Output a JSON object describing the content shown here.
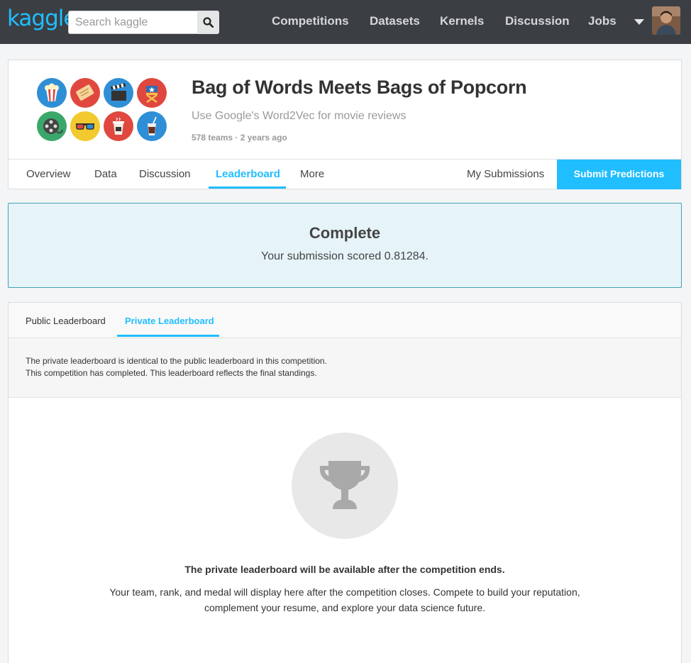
{
  "brand": {
    "logo": "kaggle",
    "accent": "#20beff",
    "nav_bg": "#3b3f44"
  },
  "search": {
    "placeholder": "Search kaggle"
  },
  "topnav": {
    "items": [
      {
        "label": "Competitions"
      },
      {
        "label": "Datasets"
      },
      {
        "label": "Kernels"
      },
      {
        "label": "Discussion"
      },
      {
        "label": "Jobs"
      }
    ]
  },
  "competition": {
    "title": "Bag of Words Meets Bags of Popcorn",
    "subtitle": "Use Google's Word2Vec for movie reviews",
    "meta": "578 teams · 2 years ago",
    "icons": [
      "popcorn-icon",
      "ticket-icon",
      "clapperboard-icon",
      "directors-chair-icon",
      "film-reel-icon",
      "3d-glasses-icon",
      "coffee-cup-icon",
      "soda-icon"
    ]
  },
  "tabs": {
    "items": [
      {
        "label": "Overview"
      },
      {
        "label": "Data"
      },
      {
        "label": "Discussion"
      },
      {
        "label": "Leaderboard",
        "active": true
      },
      {
        "label": "More"
      }
    ],
    "my_submissions": "My Submissions",
    "submit": "Submit Predictions"
  },
  "banner": {
    "title": "Complete",
    "text": "Your submission scored 0.81284."
  },
  "leaderboard": {
    "tabs": [
      {
        "label": "Public Leaderboard"
      },
      {
        "label": "Private Leaderboard",
        "active": true
      }
    ],
    "notice_line1": "The private leaderboard is identical to the public leaderboard in this competition.",
    "notice_line2": "This competition has completed. This leaderboard reflects the final standings.",
    "empty_title": "The private leaderboard will be available after the competition ends.",
    "empty_line1": "Your team, rank, and medal will display here after the competition closes. Compete to build your reputation,",
    "empty_line2": "complement your resume, and explore your data science future."
  }
}
